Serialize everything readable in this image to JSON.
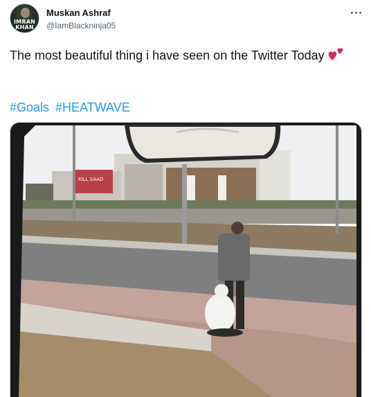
{
  "author": {
    "name": "Muskan Ashraf",
    "handle": "@IamBlackninja05",
    "avatar_text": "IMRAN\nKHAN"
  },
  "tweet": {
    "text": "The most beautiful thing i have seen on the Twitter Today",
    "emoji_icon": "two-hearts-icon",
    "hashtags": [
      "#Goals",
      "#HEATWAVE"
    ]
  },
  "media": {
    "description_icon": "photo",
    "billboard_text": "KILL SAAD"
  },
  "icons": {
    "more": "more-horizontal-icon"
  },
  "colors": {
    "link": "#1d9bf0",
    "text_primary": "#0f1419",
    "text_secondary": "#536471",
    "heart": "#e0245e"
  }
}
